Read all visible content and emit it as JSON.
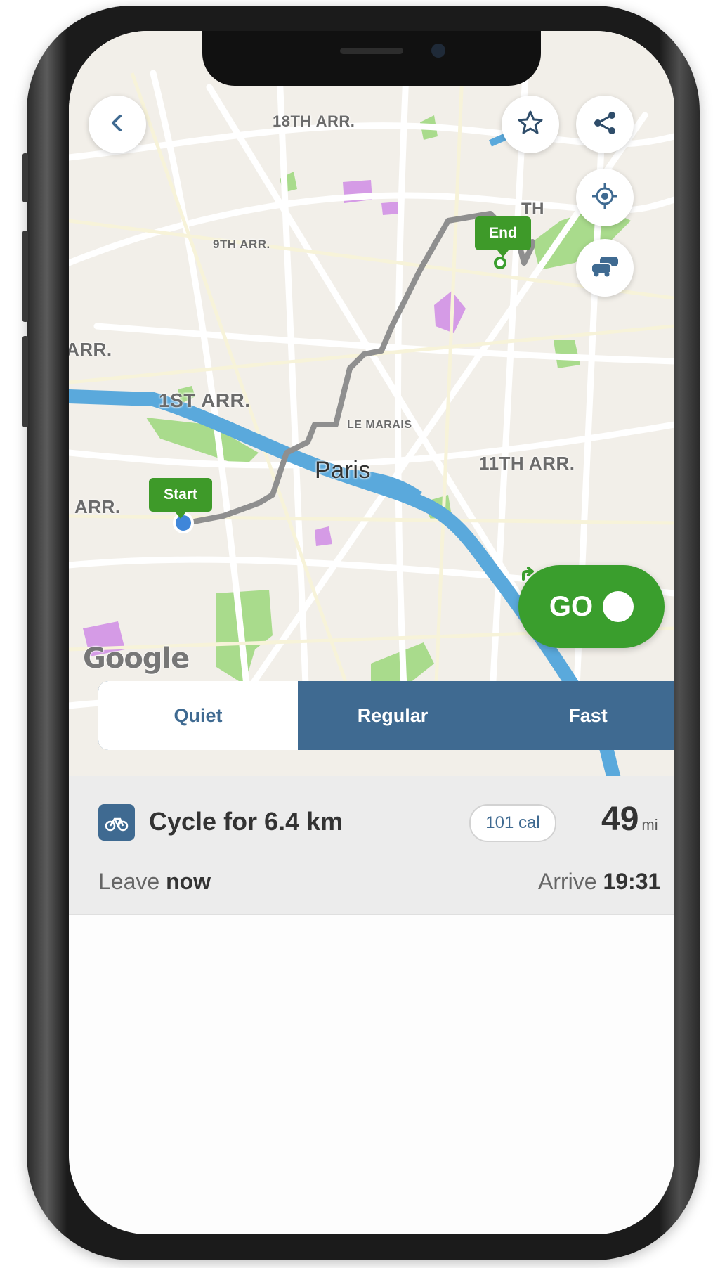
{
  "map": {
    "labels": {
      "arr18": "18TH ARR.",
      "arr9": "9TH ARR.",
      "arr_left_top": "ARR.",
      "arr1": "1ST ARR.",
      "marais": "LE MARAIS",
      "city": "Paris",
      "arr11": "11TH ARR.",
      "arr_left_bottom": "H ARR.",
      "arr_right_top": "TH"
    },
    "start_label": "Start",
    "end_label": "End",
    "attribution": "Google",
    "route_color": "#8f8f8f",
    "river_color": "#5aa9dc",
    "park_color": "#9ed77f"
  },
  "controls": {
    "back_icon": "chevron-left-icon",
    "favorite_icon": "star-icon",
    "share_icon": "share-icon",
    "locate_icon": "crosshair-icon",
    "traffic_icon": "cars-icon",
    "go_label": "GO"
  },
  "route_modes": {
    "options": [
      "Quiet",
      "Regular",
      "Fast"
    ],
    "selected": "Quiet"
  },
  "summary": {
    "cycle_text": "Cycle for 6.4 km",
    "calories": "101 cal",
    "duration_value": "49",
    "duration_unit": "mi",
    "leave_prefix": "Leave",
    "leave_value": "now",
    "arrive_prefix": "Arrive",
    "arrive_value": "19:31"
  },
  "colors": {
    "brand_green": "#3a9e2d",
    "brand_blue": "#3f6a91"
  }
}
